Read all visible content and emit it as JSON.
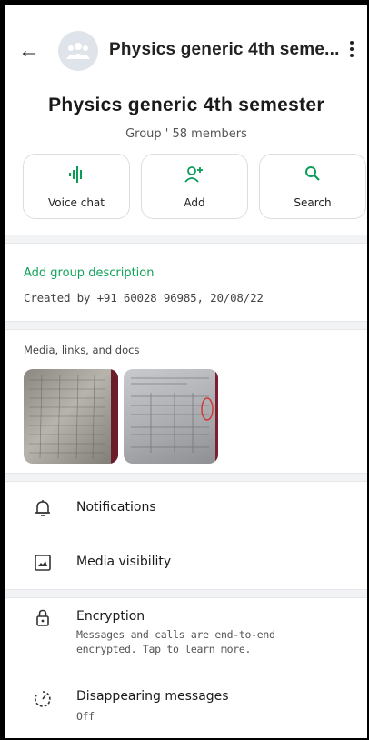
{
  "header": {
    "title": "Physics generic 4th seme...",
    "back_icon": "arrow-left-icon",
    "menu_icon": "kebab-menu-icon"
  },
  "group": {
    "name": "Physics generic 4th semester",
    "subtitle": "Group ' 58 members"
  },
  "actions": [
    {
      "label": "Voice chat",
      "icon": "voice-wave-icon"
    },
    {
      "label": "Add",
      "icon": "add-person-icon"
    },
    {
      "label": "Search",
      "icon": "search-icon"
    }
  ],
  "description": {
    "link": "Add group description",
    "created": "Created by +91 60028 96985, 20/08/22"
  },
  "media": {
    "label": "Media, links, and docs"
  },
  "settings": [
    {
      "title": "Notifications",
      "icon": "bell-icon"
    },
    {
      "title": "Media visibility",
      "icon": "image-icon"
    },
    {
      "title": "Encryption",
      "subtitle": "Messages and calls are end-to-end encrypted. Tap to learn more.",
      "icon": "lock-icon"
    },
    {
      "title": "Disappearing messages",
      "subtitle": "Off",
      "icon": "timer-icon"
    }
  ],
  "colors": {
    "accent": "#0a9d58",
    "divider": "#f2f3f5"
  }
}
